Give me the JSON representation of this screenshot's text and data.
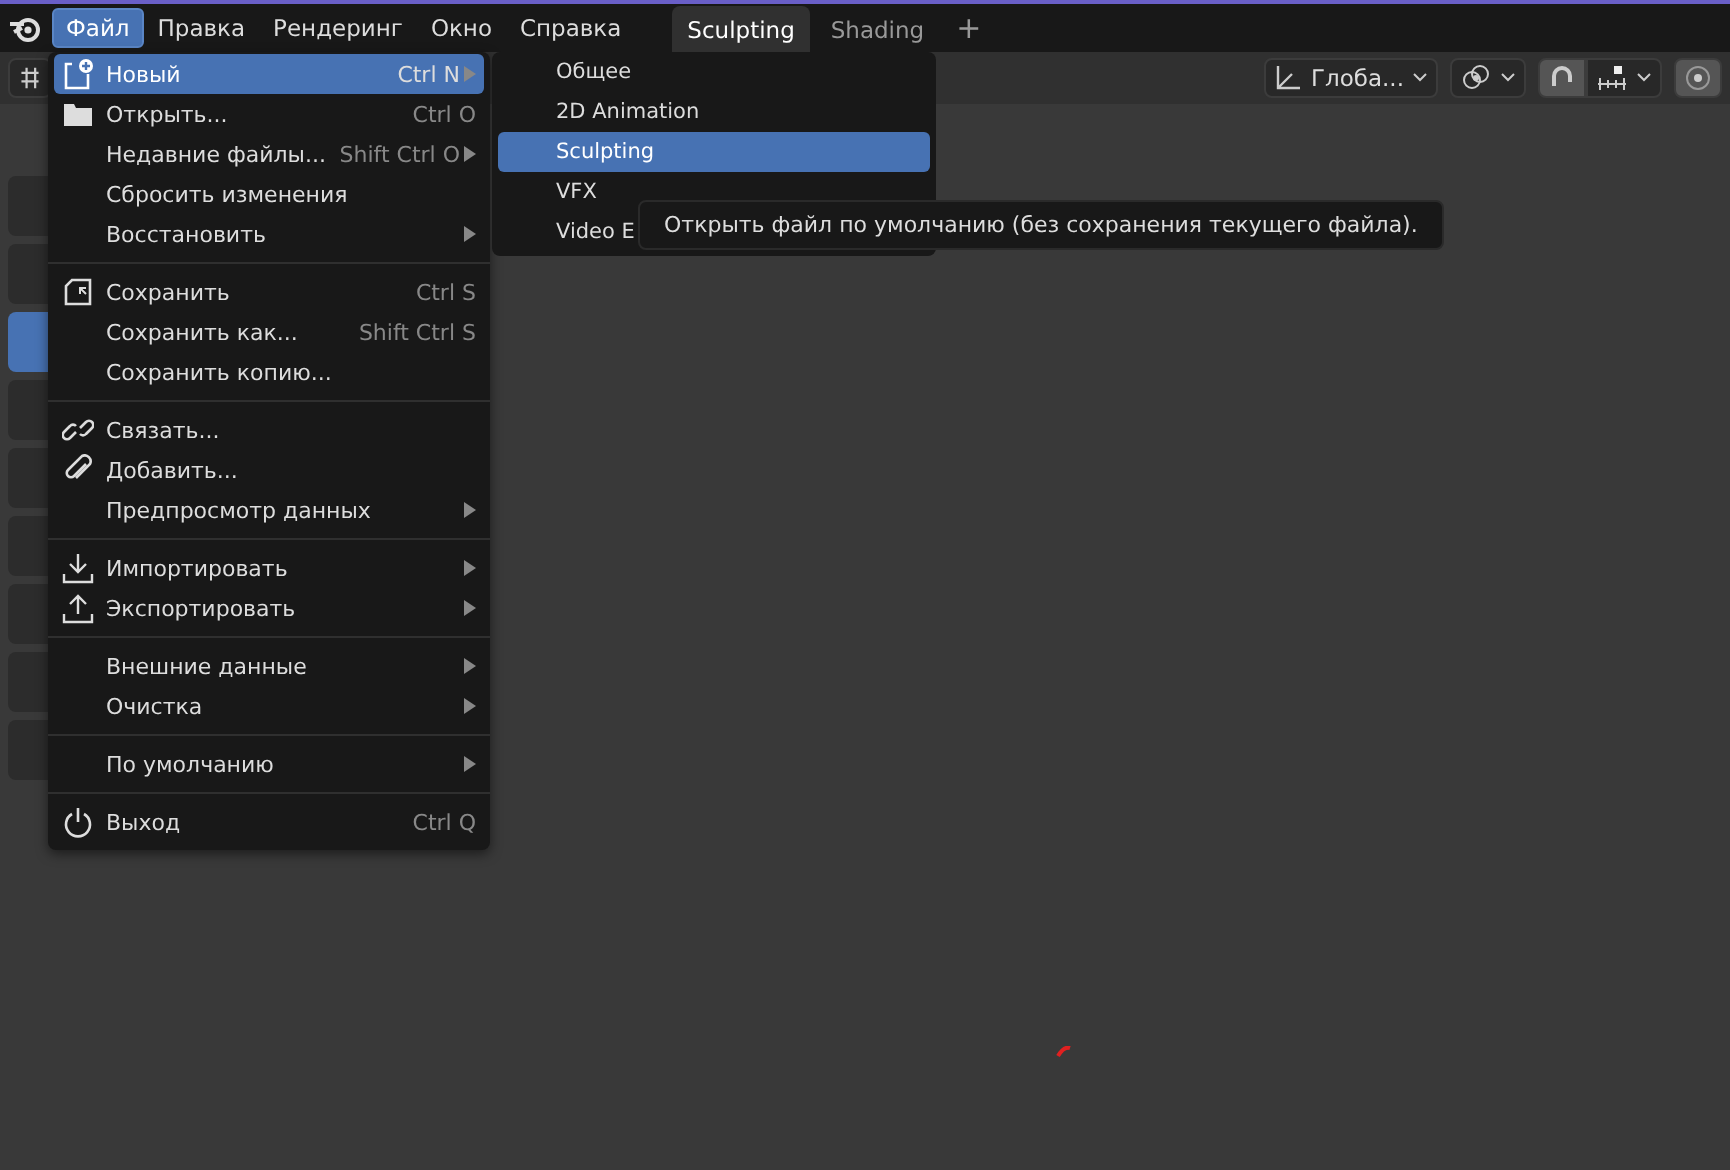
{
  "top_menu": [
    {
      "label": "Файл",
      "selected": true
    },
    {
      "label": "Правка",
      "selected": false
    },
    {
      "label": "Рендеринг",
      "selected": false
    },
    {
      "label": "Окно",
      "selected": false
    },
    {
      "label": "Справка",
      "selected": false
    }
  ],
  "workspace_tabs": [
    {
      "label": "Sculpting",
      "selected": true
    },
    {
      "label": "Shading",
      "selected": false
    }
  ],
  "add_tab": "+",
  "header": {
    "orientation": "Глоба..."
  },
  "toolbar": [
    {
      "selected": false
    },
    {
      "selected": false
    },
    {
      "selected": true
    },
    {
      "selected": false
    },
    {
      "selected": false
    },
    {
      "selected": false
    },
    {
      "selected": false
    },
    {
      "selected": false
    },
    {
      "selected": false
    }
  ],
  "file_menu": [
    {
      "kind": "item",
      "label": "Новый",
      "shortcut": "Ctrl N",
      "submenu": true,
      "selected": true
    },
    {
      "kind": "item",
      "label": "Открыть...",
      "shortcut": "Ctrl O",
      "submenu": false,
      "selected": false
    },
    {
      "kind": "item",
      "label": "Недавние файлы...",
      "shortcut": "Shift Ctrl O",
      "submenu": true,
      "selected": false
    },
    {
      "kind": "item",
      "label": "Сбросить изменения",
      "submenu": false,
      "selected": false
    },
    {
      "kind": "item",
      "label": "Восстановить",
      "submenu": true,
      "selected": false
    },
    {
      "kind": "separator"
    },
    {
      "kind": "item",
      "label": "Сохранить",
      "shortcut": "Ctrl S",
      "submenu": false,
      "selected": false
    },
    {
      "kind": "item",
      "label": "Сохранить как...",
      "shortcut": "Shift Ctrl S",
      "submenu": false,
      "selected": false
    },
    {
      "kind": "item",
      "label": "Сохранить копию...",
      "submenu": false,
      "selected": false
    },
    {
      "kind": "separator"
    },
    {
      "kind": "item",
      "label": "Связать...",
      "submenu": false,
      "selected": false
    },
    {
      "kind": "item",
      "label": "Добавить...",
      "submenu": false,
      "selected": false
    },
    {
      "kind": "item",
      "label": "Предпросмотр данных",
      "submenu": true,
      "selected": false
    },
    {
      "kind": "separator"
    },
    {
      "kind": "item",
      "label": "Импортировать",
      "submenu": true,
      "selected": false
    },
    {
      "kind": "item",
      "label": "Экспортировать",
      "submenu": true,
      "selected": false
    },
    {
      "kind": "separator"
    },
    {
      "kind": "item",
      "label": "Внешние данные",
      "submenu": true,
      "selected": false
    },
    {
      "kind": "item",
      "label": "Очистка",
      "submenu": true,
      "selected": false
    },
    {
      "kind": "separator"
    },
    {
      "kind": "item",
      "label": "По умолчанию",
      "submenu": true,
      "selected": false
    },
    {
      "kind": "separator"
    },
    {
      "kind": "item",
      "label": "Выход",
      "shortcut": "Ctrl Q",
      "submenu": false,
      "selected": false
    }
  ],
  "new_submenu": [
    {
      "label": "Общее",
      "selected": false
    },
    {
      "label": "2D Animation",
      "selected": false
    },
    {
      "label": "Sculpting",
      "selected": true
    },
    {
      "label": "VFX",
      "selected": false
    },
    {
      "label": "Video E",
      "selected": false
    }
  ],
  "tooltip": "Открыть файл по умолчанию (без сохранения текущего файла)."
}
